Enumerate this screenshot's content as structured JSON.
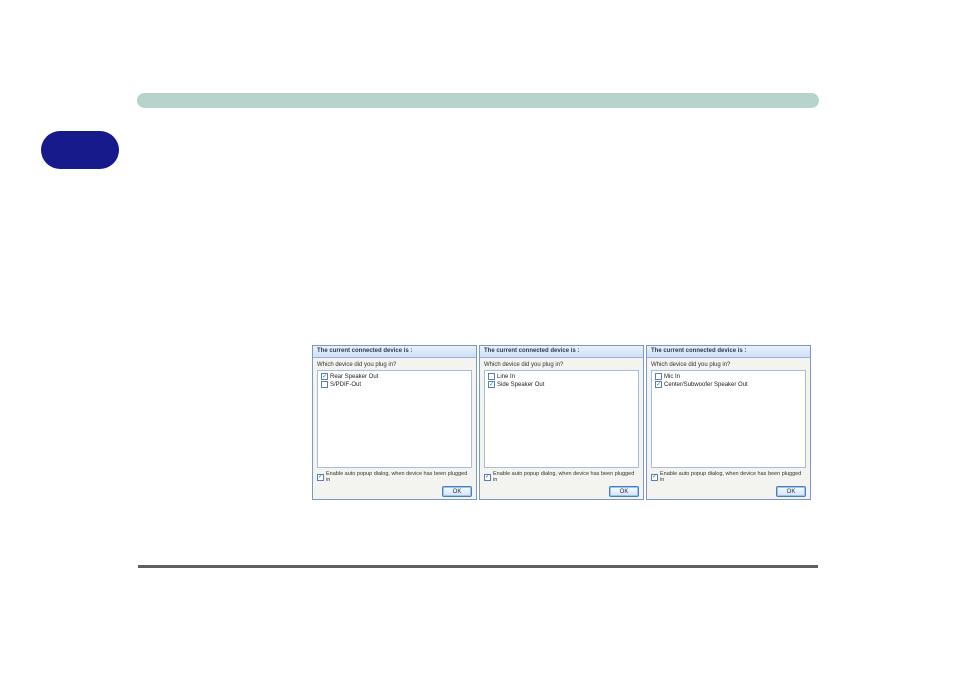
{
  "dialogs": [
    {
      "title": "The current connected device is :",
      "question": "Which device did you plug in?",
      "items": [
        {
          "checked": true,
          "label": "Rear Speaker Out"
        },
        {
          "checked": false,
          "label": "S/PDIF-Out"
        }
      ],
      "enable_popup_checked": true,
      "enable_popup_label": "Enable auto popup dialog, when device has been plugged in",
      "ok_label": "OK"
    },
    {
      "title": "The current connected device is :",
      "question": "Which device did you plug in?",
      "items": [
        {
          "checked": false,
          "label": "Line In"
        },
        {
          "checked": true,
          "label": "Side Speaker Out"
        }
      ],
      "enable_popup_checked": true,
      "enable_popup_label": "Enable auto popup dialog, when device has been plugged in",
      "ok_label": "OK"
    },
    {
      "title": "The current connected device is :",
      "question": "Which device did you plug in?",
      "items": [
        {
          "checked": false,
          "label": "Mic In"
        },
        {
          "checked": true,
          "label": "Center/Subwoofer Speaker Out"
        }
      ],
      "enable_popup_checked": true,
      "enable_popup_label": "Enable auto popup dialog, when device has been plugged in",
      "ok_label": "OK"
    }
  ]
}
